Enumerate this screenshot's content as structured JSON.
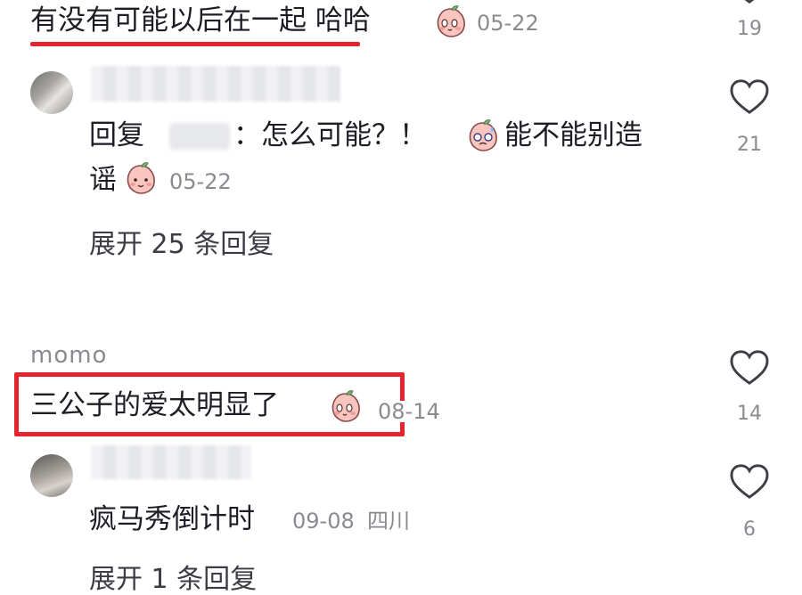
{
  "comments": [
    {
      "text": "有没有可能以后在一起 哈哈",
      "date": "05-22",
      "likes": "19",
      "icons": {
        "emoji": "blushing-peach-emoji",
        "like": "heart-outline-icon"
      }
    },
    {
      "reply_prefix": "回复",
      "reply_text": "：怎么可能？！",
      "reply_text2": "能不能别造",
      "reply_text3": "谣",
      "date": "05-22",
      "likes": "21",
      "expand": "展开 25 条回复",
      "icons": {
        "emoji1": "sweating-peach-emoji",
        "emoji2": "smiling-peach-emoji",
        "like": "heart-outline-icon"
      }
    },
    {
      "username": "momo",
      "text": "三公子的爱太明显了",
      "date": "08-14",
      "likes": "14",
      "icons": {
        "emoji": "blushing-peach-emoji",
        "like": "heart-outline-icon"
      }
    },
    {
      "text": "疯马秀倒计时",
      "date": "09-08",
      "location": "四川",
      "likes": "6",
      "expand": "展开 1 条回复",
      "icons": {
        "like": "heart-outline-icon"
      }
    }
  ],
  "colors": {
    "highlight": "#e4252d",
    "meta": "#8a8b91",
    "text": "#1d1d26"
  }
}
